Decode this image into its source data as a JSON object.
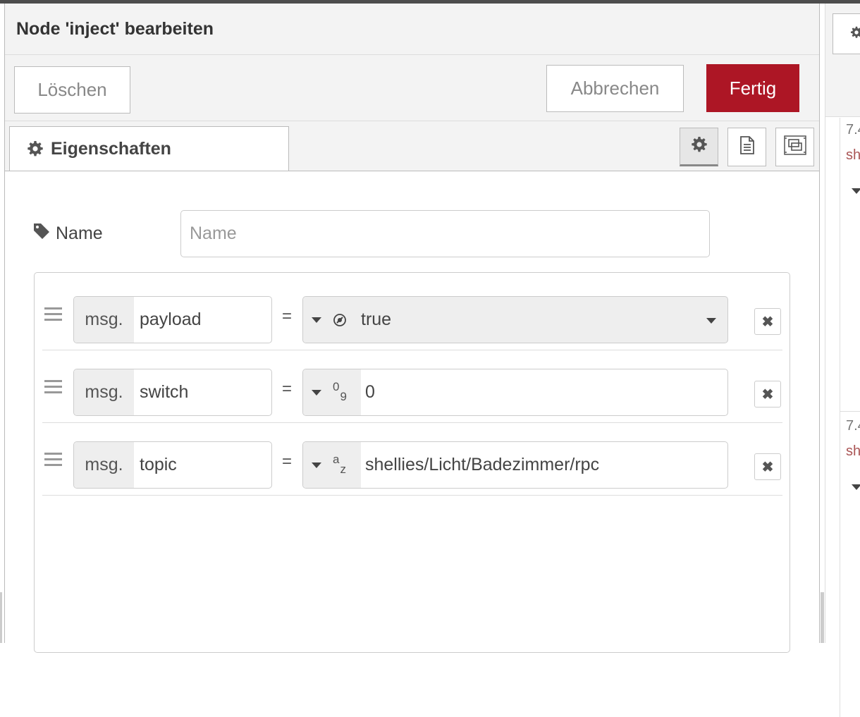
{
  "dialog": {
    "title": "Node 'inject' bearbeiten",
    "buttons": {
      "delete": "Löschen",
      "cancel": "Abbrechen",
      "done": "Fertig"
    },
    "tab": {
      "label": "Eigenschaften"
    },
    "name": {
      "label": "Name",
      "placeholder": "Name",
      "value": ""
    },
    "properties": [
      {
        "prefix": "msg.",
        "key": "payload",
        "eq": "=",
        "type": "boolean",
        "value": "true"
      },
      {
        "prefix": "msg.",
        "key": "switch",
        "eq": "=",
        "type": "number",
        "value": "0",
        "type_glyph_top": "0",
        "type_glyph_bottom": "9"
      },
      {
        "prefix": "msg.",
        "key": "topic",
        "eq": "=",
        "type": "string",
        "value": "shellies/Licht/Badezimmer/rpc",
        "type_glyph_top": "a",
        "type_glyph_bottom": "z"
      }
    ],
    "delete_row_glyph": "✖"
  },
  "sidebar": {
    "entries": [
      {
        "num": "7.4",
        "topic": "sh"
      },
      {
        "num": "7.4",
        "topic": "sh"
      }
    ]
  },
  "colors": {
    "primary": "#ad1625",
    "panel": "#f3f3f3",
    "border": "#bbbbbb"
  },
  "icons": [
    "gear-icon",
    "tag-icon",
    "file-text-icon",
    "node-appearance-icon",
    "drag-handle-icon",
    "caret-down-icon",
    "boolean-toggle-icon",
    "close-icon"
  ]
}
